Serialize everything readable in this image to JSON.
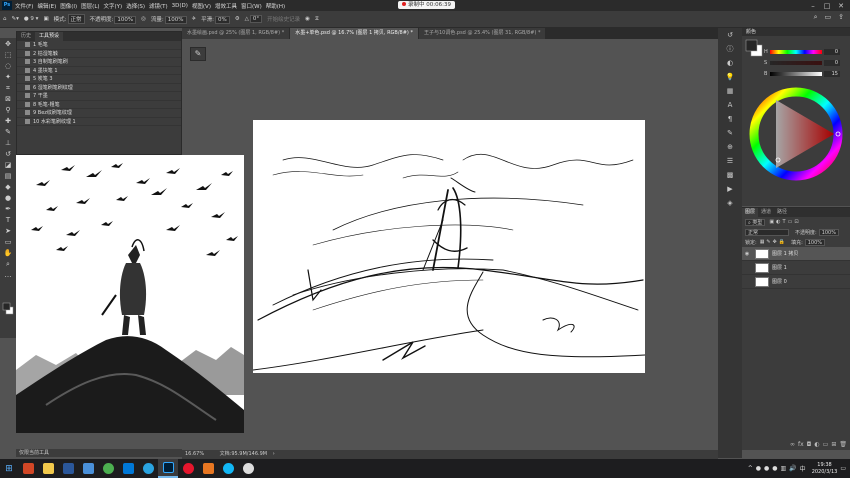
{
  "menubar": {
    "items": [
      "文件(F)",
      "编辑(E)",
      "图像(I)",
      "图层(L)",
      "文字(Y)",
      "选择(S)",
      "滤镜(T)",
      "3D(D)",
      "视图(V)",
      "增效工具",
      "窗口(W)",
      "帮助(H)"
    ],
    "recording_text": "录制中 00:06:39"
  },
  "options": {
    "mode_label": "模式:",
    "mode_value": "正常",
    "opacity_label": "不透明度:",
    "opacity_value": "100%",
    "flow_label": "流量:",
    "flow_value": "100%",
    "smooth_label": "平滑:",
    "smooth_value": "0%",
    "angle_value": "0°",
    "history_hint": "开始绘史记录"
  },
  "tabs": [
    {
      "label": "水墨绘画.psd @ 25% (图层 1, RGB/8#) *"
    },
    {
      "label": "水墨+单色.psd @ 16.7% (图层 1 拷贝, RGB/8#) *"
    },
    {
      "label": "王子与10调色.psd @ 25.4% (图层 31, RGB/8#) *"
    }
  ],
  "history_panel": {
    "tabs": [
      "历史",
      "工具预设"
    ],
    "items": [
      "1 毛笔",
      "2 枯湿笔触",
      "3 自制笔刷笔刷",
      "4 墨块笔 1",
      "5 炭笔 3",
      "6 湿笔刷笔刷纹理",
      "7 干墨",
      "8 毛笔-粗笔",
      "9 Bez纹刷笔纹理",
      "10 水彩笔刷纹理 1"
    ]
  },
  "ref_footer": "仅限当前工具",
  "status": {
    "zoom": "16.67%",
    "doc": "文档:95.9M/146.9M"
  },
  "color_panel": {
    "title": "颜色",
    "h_label": "H",
    "h_value": "0",
    "s_label": "S",
    "s_value": "0",
    "b_label": "B",
    "b_value": "15"
  },
  "layers_panel": {
    "tabs": [
      "图层",
      "通道",
      "路径"
    ],
    "filter_label": "类型",
    "blend_mode": "正常",
    "opacity_label": "不透明度:",
    "opacity_value": "100%",
    "lock_label": "锁定:",
    "fill_label": "填充:",
    "fill_value": "100%",
    "layers": [
      {
        "name": "图层 1 拷贝",
        "selected": true
      },
      {
        "name": "图层 1",
        "selected": false
      },
      {
        "name": "图层 0",
        "selected": false
      }
    ]
  },
  "taskbar": {
    "time": "19:38",
    "date": "2020/3/13"
  },
  "colors": {
    "ui_dark": "#2b2b2b",
    "ui_panel": "#3c3c3c",
    "canvas_bg": "#535353",
    "accent": "#31a8ff"
  }
}
